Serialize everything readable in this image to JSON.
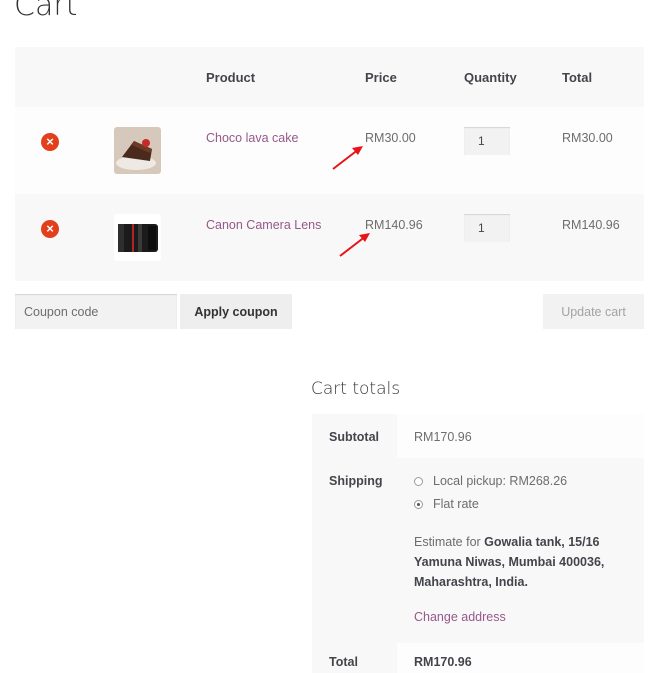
{
  "page": {
    "title": "Cart"
  },
  "cart": {
    "headers": {
      "product": "Product",
      "price": "Price",
      "quantity": "Quantity",
      "total": "Total"
    },
    "items": [
      {
        "remove_symbol": "×",
        "name": "Choco lava cake",
        "price": "RM30.00",
        "quantity": "1",
        "total": "RM30.00",
        "image": "cake-thumbnail"
      },
      {
        "remove_symbol": "×",
        "name": "Canon Camera Lens",
        "price": "RM140.96",
        "quantity": "1",
        "total": "RM140.96",
        "image": "camera-lens-thumbnail"
      }
    ]
  },
  "actions": {
    "coupon_placeholder": "Coupon code",
    "apply_coupon": "Apply coupon",
    "update_cart": "Update cart"
  },
  "totals": {
    "title": "Cart totals",
    "subtotal_label": "Subtotal",
    "subtotal_value": "RM170.96",
    "shipping_label": "Shipping",
    "shipping_options": [
      {
        "label": "Local pickup: RM268.26",
        "checked": false
      },
      {
        "label": "Flat rate",
        "checked": true
      }
    ],
    "estimate_prefix": "Estimate for",
    "estimate_address": "Gowalia tank, 15/16 Yamuna Niwas, Mumbai 400036, Maharashtra, India.",
    "change_address": "Change address",
    "total_label": "Total",
    "total_value": "RM170.96"
  },
  "colors": {
    "link": "#96588a",
    "remove": "#e2401c",
    "annotation_arrow": "#e8141a"
  }
}
